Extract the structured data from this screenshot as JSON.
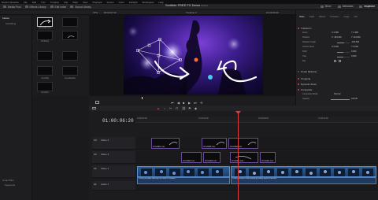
{
  "menubar": {
    "items": [
      "DaVinci Resolve",
      "File",
      "Edit",
      "Trim",
      "Timeline",
      "Clip",
      "Mark",
      "View",
      "Playback",
      "Fusion",
      "Color",
      "Fairlight",
      "Workspace",
      "Help"
    ],
    "project_title": "Scribble FREE FX Demo",
    "project_status": "Edited"
  },
  "toolbar": {
    "left": [
      "Media Pool",
      "Effects Library",
      "Edit Index",
      "Sound Library"
    ],
    "right": [
      "Mixer",
      "Metadata",
      "Inspector"
    ]
  },
  "subbar": {
    "zoom": "74%",
    "source_tc": "00:00:27:22",
    "timeline_name": "Timeline 2",
    "record_tc": "01:00:06:20",
    "inspector_target": "Timeline - ArrowAE1.mov"
  },
  "left_panel": {
    "section": "Master",
    "items": [
      "Scribbling"
    ],
    "smart_bins": "Smart Bins",
    "keywords": "Keywords"
  },
  "media_pool": {
    "clips": [
      "ArrowAE1.mov",
      "",
      "",
      "Scribbling",
      "",
      "",
      "ArrowBig",
      "ArrowMedium",
      "",
      "ArrowSm"
    ]
  },
  "inspector": {
    "tabs": [
      "Video",
      "Audio",
      "Effects",
      "Transition",
      "Image",
      "File"
    ],
    "sections": {
      "transform": "Transform",
      "smart_reframe": "Smart Reframe",
      "cropping": "Cropping",
      "dynamic_zoom": "Dynamic Zoom",
      "composite": "Composite"
    },
    "transform_rows": [
      {
        "label": "Zoom",
        "v1": "X 2.380",
        "v2": "Y 2.380"
      },
      {
        "label": "Position",
        "v1": "X -184.000",
        "v2": "Y 114.000"
      },
      {
        "label": "Rotation Angle",
        "v1": "",
        "v2": "-152.500"
      },
      {
        "label": "Anchor Point",
        "v1": "X 0.000",
        "v2": "Y 0.000"
      },
      {
        "label": "Pitch",
        "v1": "",
        "v2": "0.000"
      },
      {
        "label": "Yaw",
        "v1": "",
        "v2": "0.000"
      },
      {
        "label": "Flip",
        "v1": "",
        "v2": ""
      }
    ],
    "composite_rows": [
      {
        "label": "Composite Mode",
        "v1": "",
        "v2": "Normal"
      },
      {
        "label": "Opacity",
        "v1": "",
        "v2": "100.00"
      }
    ]
  },
  "timeline": {
    "timecode": "01:00:06:20",
    "ruler_ticks": [
      "01:00:00:00",
      "01:00:04:00",
      "01:00:08:00",
      "01:00:12:00"
    ],
    "tracks": [
      {
        "id": "V3",
        "name": "Video 3"
      },
      {
        "id": "V2",
        "name": "Video 2"
      },
      {
        "id": "V1",
        "name": "Video 1"
      },
      {
        "id": "A1",
        "name": "Audio 1"
      }
    ],
    "v3_clips": [
      "ArrowAE1.mov",
      "ArrowAE5.mov",
      "ArrowAE1.mov"
    ],
    "v2_clips": [
      "ArrowAE4.mov",
      "ArrowAE4.mov",
      "ArrowAE1.mov",
      "ArrowAE1.mov"
    ],
    "audio_clips": [
      "STRG_AA party dancing live music in festival...",
      "STRG_AA edm crowd jumping pulsing lights at festival..."
    ]
  }
}
